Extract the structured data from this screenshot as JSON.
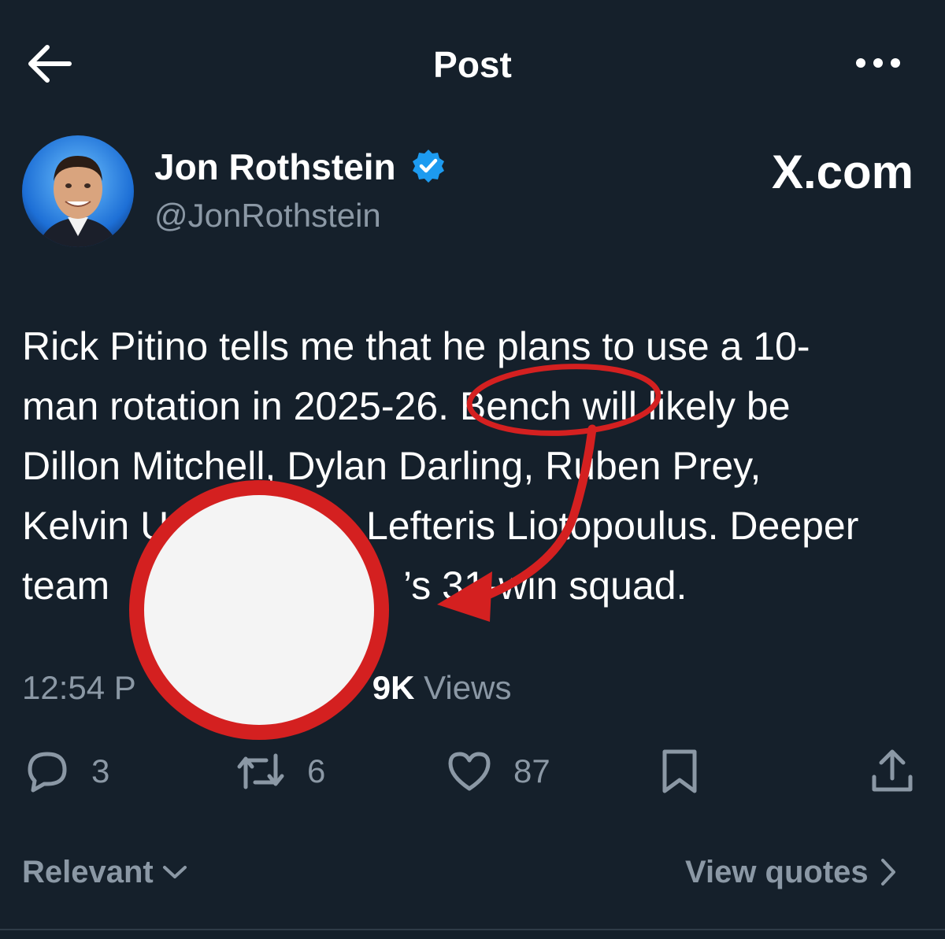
{
  "header": {
    "title": "Post"
  },
  "author": {
    "name": "Jon Rothstein",
    "handle": "@JonRothstein",
    "verified": true
  },
  "watermark": "X.com",
  "post": {
    "lines": [
      "Rick Pitino tells me that he plans to use a 10-",
      "man rotation in 2025-26. Bench will likely be",
      "Dillon Mitchell, Dylan Darling, Ruben Prey,",
      "Kelvin U",
      "team",
      "’s 31-win squad."
    ],
    "line4_tail": "Lefteris Liotopoulus. Deeper"
  },
  "meta": {
    "time": "12:54 P",
    "views_count": "9K",
    "views_label": "Views"
  },
  "actions": {
    "replies": "3",
    "reposts": "6",
    "likes": "87"
  },
  "footer": {
    "sort_label": "Relevant",
    "view_quotes": "View quotes"
  },
  "annotation": {
    "highlighted_word": "Bench",
    "circle_color": "#d42020"
  },
  "icons": [
    "back-arrow-icon",
    "more-icon",
    "verified-badge-icon",
    "reply-icon",
    "repost-icon",
    "like-icon",
    "bookmark-icon",
    "share-icon",
    "chevron-down-icon",
    "chevron-right-icon"
  ],
  "colors": {
    "background": "#15202b",
    "secondary_text": "#8b98a5",
    "verified_blue": "#1d9bf0",
    "annotation_red": "#d42020"
  }
}
